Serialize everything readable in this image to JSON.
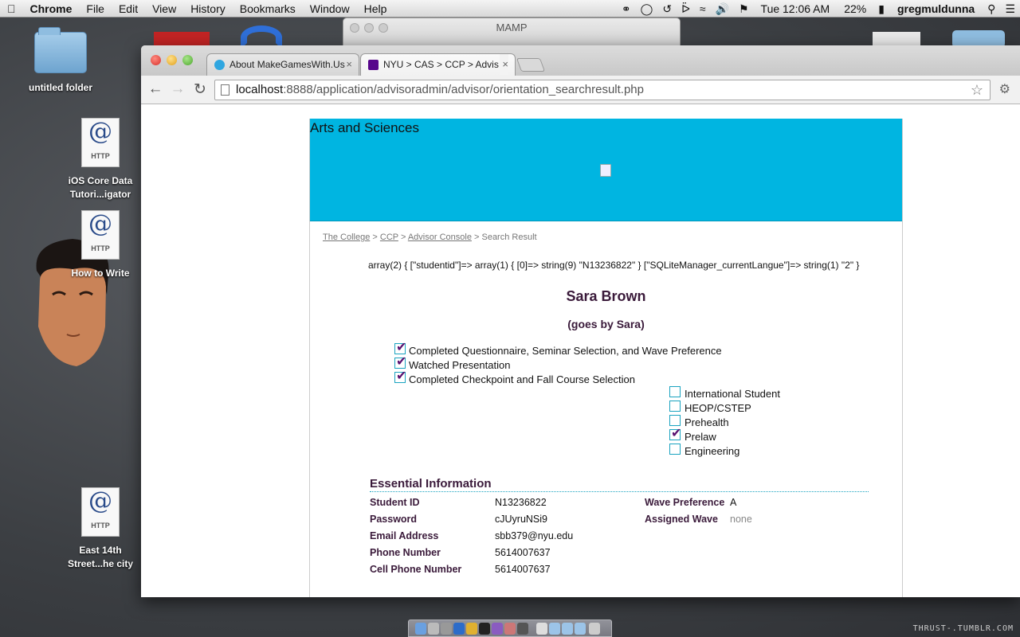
{
  "menubar": {
    "apple": "",
    "app_name": "Chrome",
    "items": [
      "File",
      "Edit",
      "View",
      "History",
      "Bookmarks",
      "Window",
      "Help"
    ],
    "clock": "Tue 12:06 AM",
    "battery": "22%",
    "user": "gregmuldunna"
  },
  "desktop": {
    "icons": [
      {
        "label_1": "untitled folder",
        "label_2": ""
      },
      {
        "label_1": "iOS Core Data",
        "label_2": "Tutori...igator",
        "badge": "HTTP"
      },
      {
        "label_1": "How to Write",
        "label_2": "",
        "badge": "HTTP"
      },
      {
        "label_1": "East 14th",
        "label_2": "Street...he city",
        "badge": "HTTP"
      }
    ],
    "watermark": "THRUST-.TUMBLR.COM"
  },
  "mamp": {
    "title": "MAMP"
  },
  "browser": {
    "tabs": [
      {
        "title": "About MakeGamesWith.Us",
        "close": "×"
      },
      {
        "title": "NYU > CAS > CCP > Advis",
        "close": "×"
      }
    ],
    "url_host": "localhost",
    "url_rest": ":8888/application/advisoradmin/advisor/orientation_searchresult.php"
  },
  "page": {
    "header_title": "Arts and Sciences",
    "breadcrumb": {
      "college": "The College",
      "ccp": "CCP",
      "console": "Advisor Console",
      "current": "Search Result",
      "sep": " > "
    },
    "dump": "array(2) { [\"studentid\"]=> array(1) { [0]=> string(9) \"N13236822\" } [\"SQLiteManager_currentLangue\"]=> string(1) \"2\" }",
    "student_name": "Sara Brown",
    "nickname": "(goes by Sara)",
    "progress": [
      {
        "label": "Completed Questionnaire, Seminar Selection, and Wave Preference",
        "checked": true
      },
      {
        "label": "Watched Presentation",
        "checked": true
      },
      {
        "label": "Completed Checkpoint and Fall Course Selection",
        "checked": true
      }
    ],
    "categories": [
      {
        "label": "International Student",
        "checked": false
      },
      {
        "label": "HEOP/CSTEP",
        "checked": false
      },
      {
        "label": "Prehealth",
        "checked": false
      },
      {
        "label": "Prelaw",
        "checked": true
      },
      {
        "label": "Engineering",
        "checked": false
      }
    ],
    "essential": {
      "heading": "Essential Information",
      "student_id_label": "Student ID",
      "student_id": "N13236822",
      "password_label": "Password",
      "password": "cJUyruNSi9",
      "email_label": "Email Address",
      "email": "sbb379@nyu.edu",
      "phone_label": "Phone Number",
      "phone": "5614007637",
      "cell_label": "Cell Phone Number",
      "cell": "5614007637",
      "wave_pref_label": "Wave Preference",
      "wave_pref": "A",
      "assigned_wave_label": "Assigned Wave",
      "assigned_wave": "none"
    }
  },
  "colors": {
    "header": "#00b5e1",
    "heading_text": "#3a1a3a",
    "checkbox_border": "#1aa3c0"
  }
}
